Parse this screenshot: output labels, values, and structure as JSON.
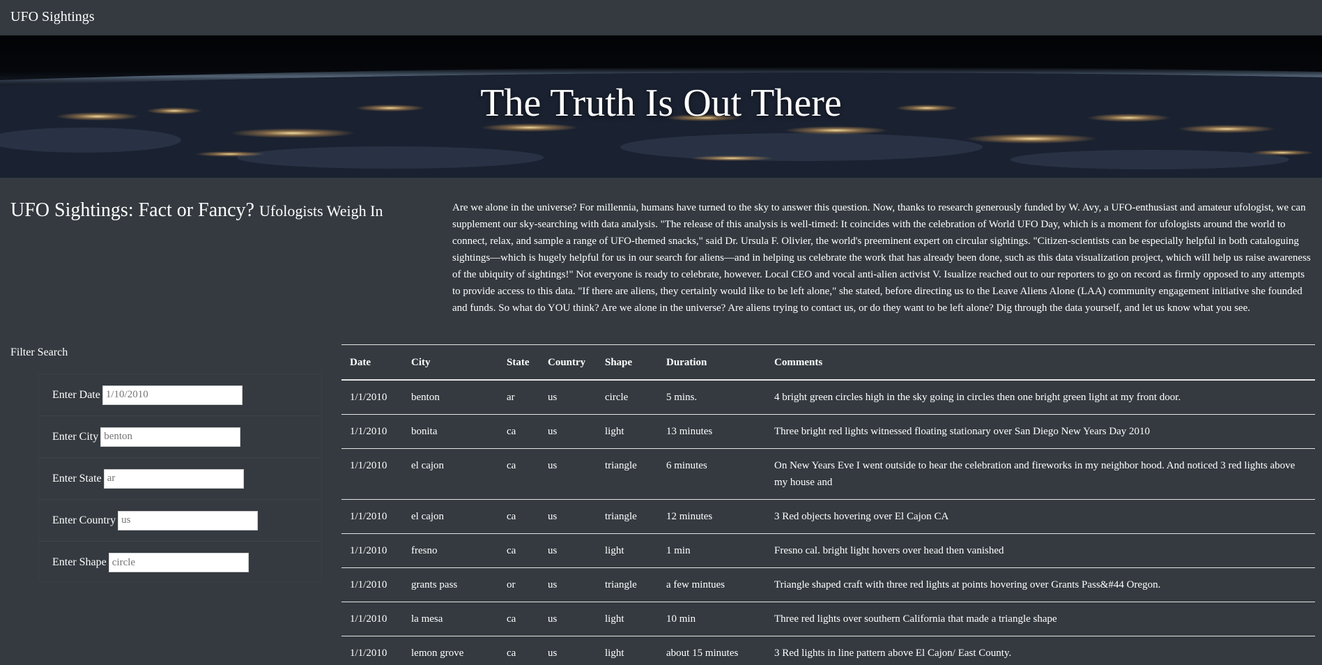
{
  "nav": {
    "brand": "UFO Sightings"
  },
  "hero": {
    "title": "The Truth Is Out There"
  },
  "heading": {
    "main": "UFO Sightings: Fact or Fancy?",
    "sub": "Ufologists Weigh In"
  },
  "article": "Are we alone in the universe? For millennia, humans have turned to the sky to answer this question. Now, thanks to research generously funded by W. Avy, a UFO-enthusiast and amateur ufologist, we can supplement our sky-searching with data analysis. \"The release of this analysis is well-timed: It coincides with the celebration of World UFO Day, which is a moment for ufologists around the world to connect, relax, and sample a range of UFO-themed snacks,\" said Dr. Ursula F. Olivier, the world's preeminent expert on circular sightings. \"Citizen-scientists can be especially helpful in both cataloguing sightings—which is hugely helpful for us in our search for aliens—and in helping us celebrate the work that has already been done, such as this data visualization project, which will help us raise awareness of the ubiquity of sightings!\" Not everyone is ready to celebrate, however. Local CEO and vocal anti-alien activist V. Isualize reached out to our reporters to go on record as firmly opposed to any attempts to provide access to this data. \"If there are aliens, they certainly would like to be left alone,\" she stated, before directing us to the Leave Aliens Alone (LAA) community engagement initiative she founded and funds. So what do YOU think? Are we alone in the universe? Are aliens trying to contact us, or do they want to be left alone? Dig through the data yourself, and let us know what you see.",
  "filter": {
    "title": "Filter Search",
    "date": {
      "label": "Enter Date",
      "placeholder": "1/10/2010"
    },
    "city": {
      "label": "Enter City",
      "placeholder": "benton"
    },
    "state": {
      "label": "Enter State",
      "placeholder": "ar"
    },
    "country": {
      "label": "Enter Country",
      "placeholder": "us"
    },
    "shape": {
      "label": "Enter Shape",
      "placeholder": "circle"
    }
  },
  "table": {
    "headers": [
      "Date",
      "City",
      "State",
      "Country",
      "Shape",
      "Duration",
      "Comments"
    ],
    "rows": [
      [
        "1/1/2010",
        "benton",
        "ar",
        "us",
        "circle",
        "5 mins.",
        "4 bright green circles high in the sky going in circles then one bright green light at my front door."
      ],
      [
        "1/1/2010",
        "bonita",
        "ca",
        "us",
        "light",
        "13 minutes",
        "Three bright red lights witnessed floating stationary over San Diego New Years Day 2010"
      ],
      [
        "1/1/2010",
        "el cajon",
        "ca",
        "us",
        "triangle",
        "6 minutes",
        "On New Years Eve I went outside to hear the celebration and fireworks in my neighbor hood. And noticed 3 red lights above my house and"
      ],
      [
        "1/1/2010",
        "el cajon",
        "ca",
        "us",
        "triangle",
        "12 minutes",
        "3 Red objects hovering over El Cajon CA"
      ],
      [
        "1/1/2010",
        "fresno",
        "ca",
        "us",
        "light",
        "1 min",
        "Fresno cal. bright light hovers over head then vanished"
      ],
      [
        "1/1/2010",
        "grants pass",
        "or",
        "us",
        "triangle",
        "a few mintues",
        "Triangle shaped craft with three red lights at points hovering over Grants Pass&#44 Oregon."
      ],
      [
        "1/1/2010",
        "la mesa",
        "ca",
        "us",
        "light",
        "10 min",
        "Three red lights over southern California that made a triangle shape"
      ],
      [
        "1/1/2010",
        "lemon grove",
        "ca",
        "us",
        "light",
        "about 15 minutes",
        "3 Red lights in line pattern above El Cajon/ East County."
      ]
    ]
  }
}
